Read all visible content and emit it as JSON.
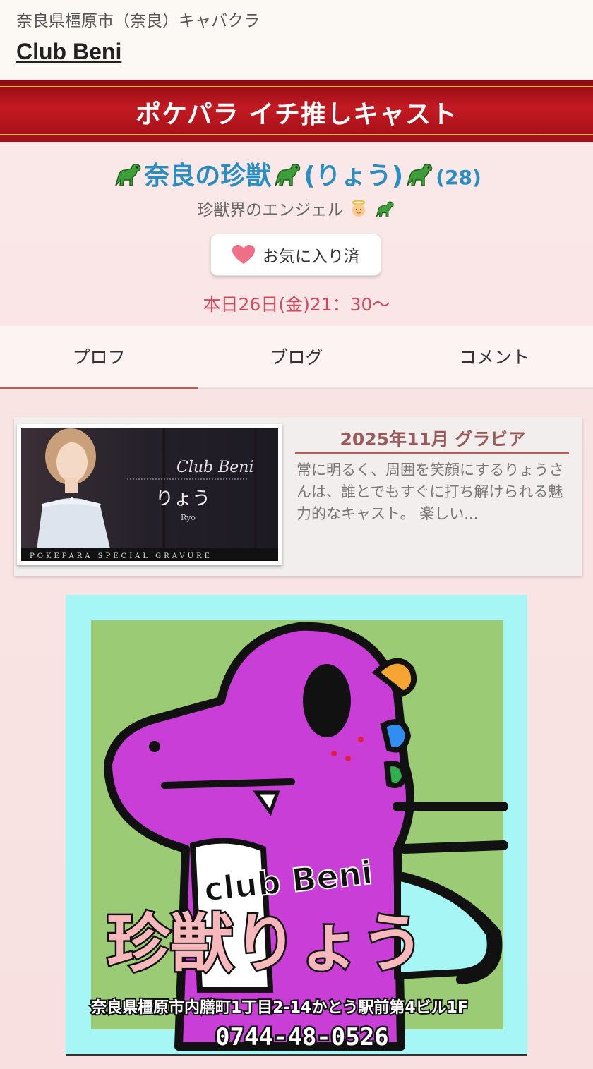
{
  "header": {
    "area": "奈良県橿原市（奈良）キャバクラ",
    "shop_name": "Club Beni"
  },
  "banner": {
    "title": "ポケパラ イチ推しキャスト"
  },
  "cast": {
    "name": "奈良の珍獣",
    "reading": "(りょう)",
    "age": "(28)",
    "catchphrase": "珍獣界のエンジェル",
    "favorite_label": "お気に入り済",
    "schedule": "本日26日(金)21：30～"
  },
  "tabs": [
    {
      "label": "プロフ",
      "active": true
    },
    {
      "label": "ブログ",
      "active": false
    },
    {
      "label": "コメント",
      "active": false
    }
  ],
  "gravure": {
    "title": "2025年11月 グラビア",
    "text": "常に明るく、周囲を笑顔にするりょうさんは、誰とでもすぐに打ち解けられる魅力的なキャスト。 楽しい...",
    "photo_club": "Club Beni",
    "photo_name": "りょう",
    "photo_roman": "Ryo",
    "photo_footer": "POKEPARA SPECIAL GRAVURE"
  },
  "poster": {
    "club": "club Beni",
    "name": "珍獣りょう",
    "address": "奈良県橿原市内膳町1丁目2-14かとう駅前第4ビル1F",
    "phone": "0744-48-0526"
  },
  "colors": {
    "accent_blue": "#2a8fc0",
    "banner_red": "#c41a22",
    "schedule_red": "#d0485a",
    "tab_active": "#a8625e"
  }
}
